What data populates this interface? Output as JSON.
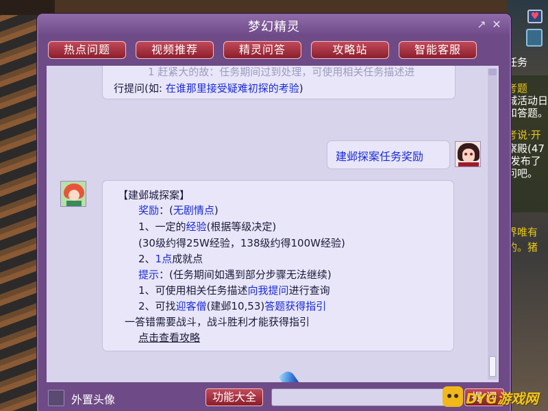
{
  "window": {
    "title": "梦幻精灵",
    "restore_glyph": "↗",
    "close_glyph": "✕"
  },
  "tabs": [
    {
      "label": "热点问题"
    },
    {
      "label": "视频推荐"
    },
    {
      "label": "精灵问答"
    },
    {
      "label": "攻略站"
    },
    {
      "label": "智能客服"
    }
  ],
  "messages": {
    "prev_bot": {
      "line1": "1 赶紧大的故：任务期间过到处理，可使用相关任务描述进",
      "line2_prefix": "行提问(如: ",
      "line2_link": "在谁那里接受疑难初探的考验",
      "line2_suffix": ")"
    },
    "user_question": "建邺探案任务奖励",
    "bot_answer": {
      "heading": "【建邺城探案】",
      "reward_label": "奖励",
      "reward_sep": "：(",
      "reward_note": "无剧情点",
      "reward_close": ")",
      "item1_prefix": "1、一定的",
      "item1_highlight": "经验",
      "item1_suffix": "(根据等级决定)",
      "item1_detail": "(30级约得25W经验，138级约得100W经验)",
      "item2_prefix": "2、",
      "item2_highlight": "1点",
      "item2_suffix": "成就点",
      "tip_label": "提示",
      "tip_text": "：(任务期间如遇到部分步骤无法继续)",
      "tip1_prefix": "1、可使用相关任务描述",
      "tip1_highlight": "向我提问",
      "tip1_suffix": "进行查询",
      "tip2_prefix": "2、可找",
      "tip2_highlight1": "迎客僧",
      "tip2_mid": "(建邺10,53)",
      "tip2_highlight2": "答题获得指引",
      "tip2_cont": "一答错需要战斗，战斗胜利才能获得指引",
      "link": "点击查看攻略"
    }
  },
  "bottom": {
    "avatar_toggle_label": "外置头像",
    "features_button": "功能大全",
    "input_value": "",
    "ask_button": "提 问"
  },
  "background_chat": {
    "right_lines": [
      "任务",
      "考题",
      "城活动日",
      "和答题。",
      "考说·开",
      "察殿(47",
      "·发布了",
      "问吧。",
      "界唯有",
      "的。猪"
    ]
  },
  "watermark": {
    "text": "DYG游戏网"
  },
  "colors": {
    "window": "#6e4a86",
    "tab_button": "#b03a4a",
    "chat_bg": "#d8d4ec",
    "link_blue": "#1a2ad8",
    "link_purple": "#9a1ad8",
    "watermark_gold": "#f0c81a"
  }
}
